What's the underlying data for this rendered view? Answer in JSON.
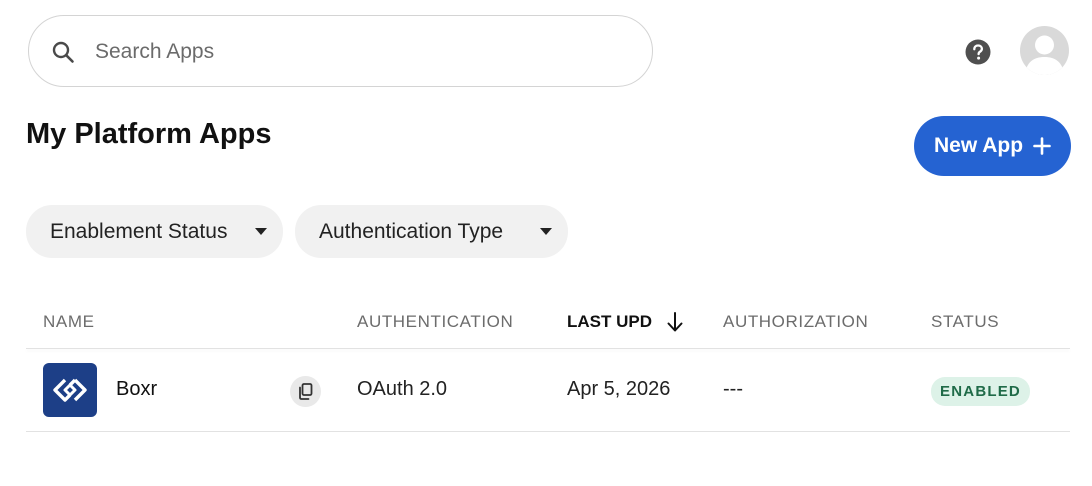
{
  "search": {
    "placeholder": "Search Apps"
  },
  "header": {
    "help_icon": "question-circle-icon",
    "avatar_icon": "user-silhouette-icon"
  },
  "page": {
    "title": "My Platform Apps"
  },
  "actions": {
    "new_app_label": "New App",
    "new_app_icon": "plus-icon"
  },
  "filters": [
    {
      "label": "Enablement Status"
    },
    {
      "label": "Authentication Type"
    }
  ],
  "table": {
    "columns": [
      "NAME",
      "AUTHENTICATION",
      "LAST UPD",
      "AUTHORIZATION",
      "STATUS"
    ],
    "sort": {
      "column": "LAST UPD",
      "direction": "descending"
    },
    "rows": [
      {
        "name": "Boxr",
        "authentication": "OAuth 2.0",
        "last_updated": "Apr 5, 2026",
        "authorization": "---",
        "status": "ENABLED"
      }
    ]
  },
  "colors": {
    "primary": "#2563d2",
    "app_logo": "#1d3f87",
    "badge_bg": "#ddf2e8",
    "badge_text": "#1f6b48"
  }
}
